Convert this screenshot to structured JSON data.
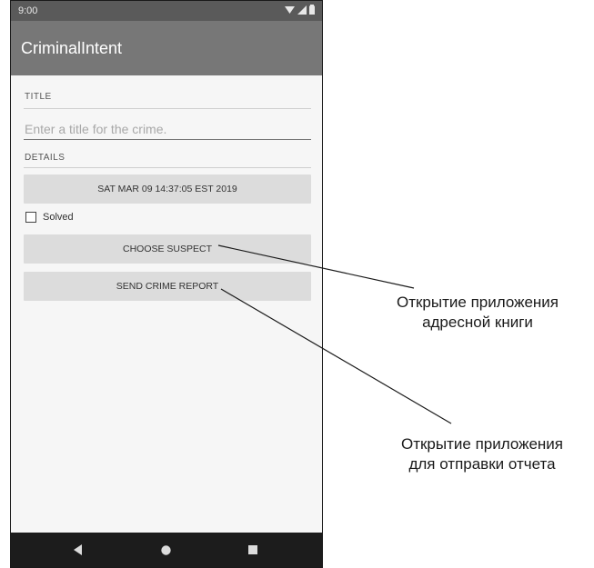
{
  "status_bar": {
    "time": "9:00",
    "icons": [
      "wifi-icon",
      "signal-icon",
      "battery-icon"
    ]
  },
  "app_bar": {
    "title": "CriminalIntent"
  },
  "form": {
    "title_label": "TITLE",
    "title_input": {
      "value": "",
      "placeholder": "Enter a title for the crime."
    },
    "details_label": "DETAILS",
    "date_button": "SAT MAR 09 14:37:05 EST 2019",
    "solved_checkbox": {
      "label": "Solved",
      "checked": false
    },
    "choose_suspect_button": "CHOOSE SUSPECT",
    "send_report_button": "SEND CRIME REPORT"
  },
  "nav_bar": {
    "icons": [
      "back-icon",
      "home-icon",
      "recents-icon"
    ]
  },
  "callouts": {
    "choose_suspect": {
      "line1": "Открытие приложения",
      "line2": "адресной книги"
    },
    "send_report": {
      "line1": "Открытие приложения",
      "line2": "для отправки отчета"
    }
  },
  "colors": {
    "status_bar": "#5a5a5a",
    "app_bar": "#777777",
    "button": "#dcdcdc",
    "nav_bar": "#1c1c1c",
    "background": "#f6f6f6"
  }
}
